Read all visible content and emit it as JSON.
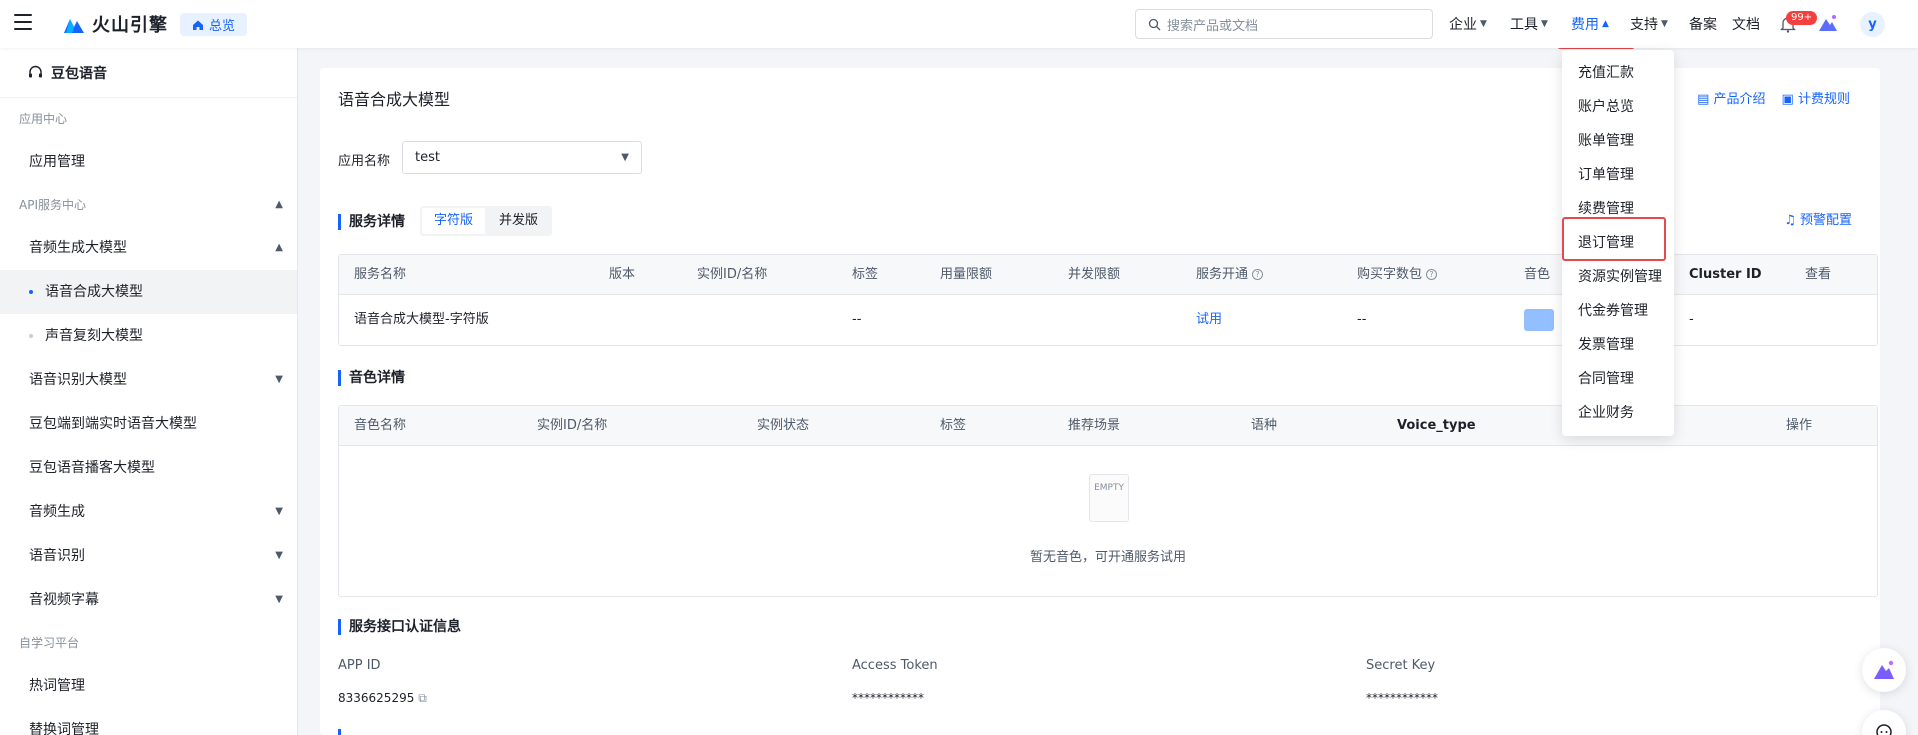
{
  "brand": {
    "name": "火山引擎",
    "home_label": "总览"
  },
  "search": {
    "placeholder": "搜索产品或文档"
  },
  "topnav": [
    {
      "label": "企业",
      "has_chevron": true
    },
    {
      "label": "工具",
      "has_chevron": true
    },
    {
      "label": "费用",
      "has_chevron": true,
      "active": true
    },
    {
      "label": "支持",
      "has_chevron": true
    },
    {
      "label": "备案",
      "has_chevron": false
    },
    {
      "label": "文档",
      "has_chevron": false
    }
  ],
  "notifications": {
    "badge": "99+"
  },
  "user": {
    "avatar_letter": "y"
  },
  "sidebar": {
    "title": "豆包语音",
    "items": [
      {
        "type": "group",
        "label": "应用中心"
      },
      {
        "type": "item",
        "label": "应用管理"
      },
      {
        "type": "group",
        "label": "API服务中心",
        "chevron": "up"
      },
      {
        "type": "item",
        "label": "音频生成大模型",
        "chevron": "up"
      },
      {
        "type": "sub",
        "label": "语音合成大模型",
        "active": true
      },
      {
        "type": "sub",
        "label": "声音复刻大模型"
      },
      {
        "type": "item",
        "label": "语音识别大模型",
        "chevron": "down"
      },
      {
        "type": "item",
        "label": "豆包端到端实时语音大模型"
      },
      {
        "type": "item",
        "label": "豆包语音播客大模型"
      },
      {
        "type": "item",
        "label": "音频生成",
        "chevron": "down"
      },
      {
        "type": "item",
        "label": "语音识别",
        "chevron": "down"
      },
      {
        "type": "item",
        "label": "音视频字幕",
        "chevron": "down"
      },
      {
        "type": "group",
        "label": "自学习平台"
      },
      {
        "type": "item",
        "label": "热词管理"
      },
      {
        "type": "item",
        "label": "替换词管理"
      }
    ]
  },
  "main": {
    "title": "语音合成大模型",
    "product_intro": "产品介绍",
    "billing_rules": "计费规则",
    "app_name_label": "应用名称",
    "app_name_value": "test",
    "service_section": "服务详情",
    "seg_tabs": [
      "字符版",
      "并发版"
    ],
    "alert_config": "预警配置",
    "service_table": {
      "headers": [
        "服务名称",
        "版本",
        "实例ID/名称",
        "标签",
        "用量限额",
        "并发限额",
        "服务开通",
        "购买字数包",
        "音色",
        "Cluster ID",
        "查看"
      ],
      "row": {
        "name": "语音合成大模型-字符版",
        "tag": "--",
        "open": "试用",
        "package": "--",
        "cluster": "-"
      }
    },
    "voice_section": "音色详情",
    "voice_table": {
      "headers": [
        "音色名称",
        "实例ID/名称",
        "实例状态",
        "标签",
        "推荐场景",
        "语种",
        "Voice_type",
        "操作"
      ],
      "empty_text": "暂无音色，可开通服务试用",
      "empty_icon_text": "EMPTY"
    },
    "auth_section": "服务接口认证信息",
    "credentials": {
      "app_id_label": "APP ID",
      "app_id": "8336625295",
      "token_label": "Access Token",
      "token": "************",
      "secret_label": "Secret Key",
      "secret": "************"
    }
  },
  "billing_menu": [
    "充值汇款",
    "账户总览",
    "账单管理",
    "订单管理",
    "续费管理",
    "退订管理",
    "资源实例管理",
    "代金券管理",
    "发票管理",
    "合同管理",
    "企业财务"
  ],
  "colors": {
    "accent": "#1664ff",
    "highlight": "#e5484d",
    "badge": "#f53f3f"
  }
}
